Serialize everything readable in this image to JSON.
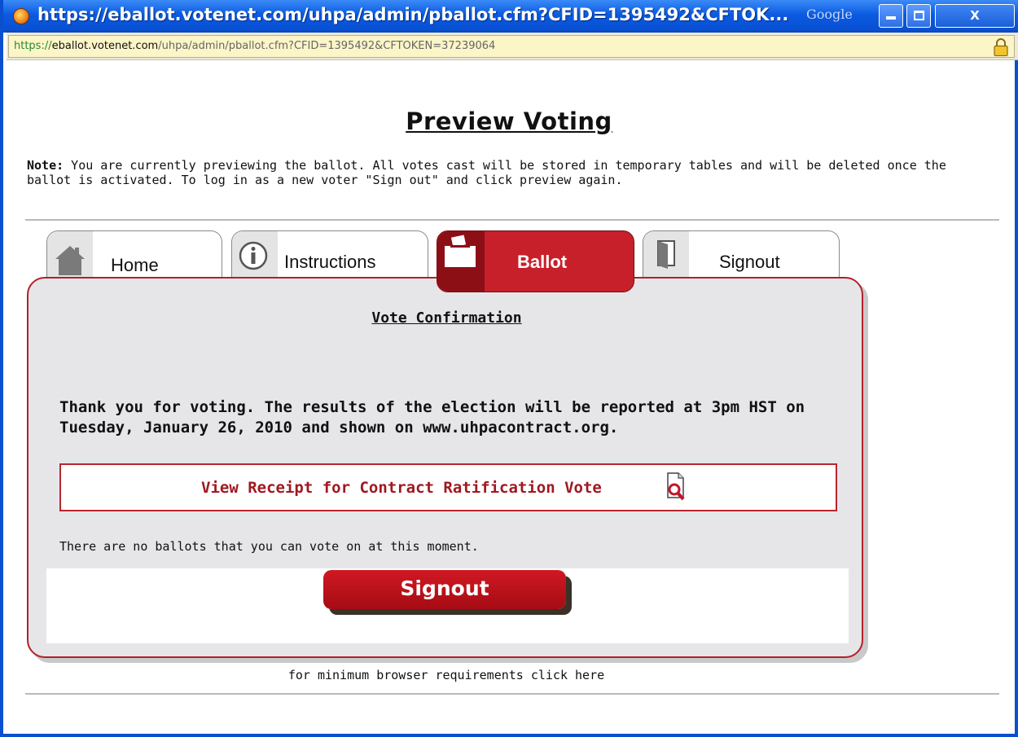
{
  "window": {
    "title": "https://eballot.votenet.com/uhpa/admin/pballot.cfm?CFID=1395492&CFTOK...",
    "search_engine_label": "Google",
    "close_glyph": "X"
  },
  "address_bar": {
    "scheme": "https://",
    "host": "eballot.votenet.com",
    "path": "/uhpa/admin/pballot.cfm?CFID=1395492&CFTOKEN=37239064"
  },
  "page": {
    "title": "Preview Voting",
    "note_label": "Note:",
    "note_text": " You are currently previewing the ballot. All votes cast will be stored in temporary tables and will be deleted once the ballot is activated. To log in as a new voter \"Sign out\" and click preview again.",
    "footer_link": "for minimum browser requirements click here"
  },
  "tabs": [
    {
      "label": "Home",
      "icon": "home-icon"
    },
    {
      "label": "Instructions",
      "icon": "info-icon"
    },
    {
      "label": "Ballot",
      "icon": "ballot-box-icon",
      "active": true
    },
    {
      "label": "Signout",
      "icon": "door-icon"
    }
  ],
  "panel": {
    "heading": "Vote Confirmation",
    "thanks": "Thank you for voting. The results of the election will be reported at 3pm HST on Tuesday, January 26, 2010 and shown on www.uhpacontract.org.",
    "receipt_link": "View Receipt for Contract Ratification Vote",
    "no_ballots": "There are no ballots that you can vote on at this moment.",
    "signout_button": "Signout"
  },
  "colors": {
    "accent_red": "#c8202a",
    "titlebar_blue": "#0b5ae0",
    "panel_bg": "#e6e6e9"
  }
}
